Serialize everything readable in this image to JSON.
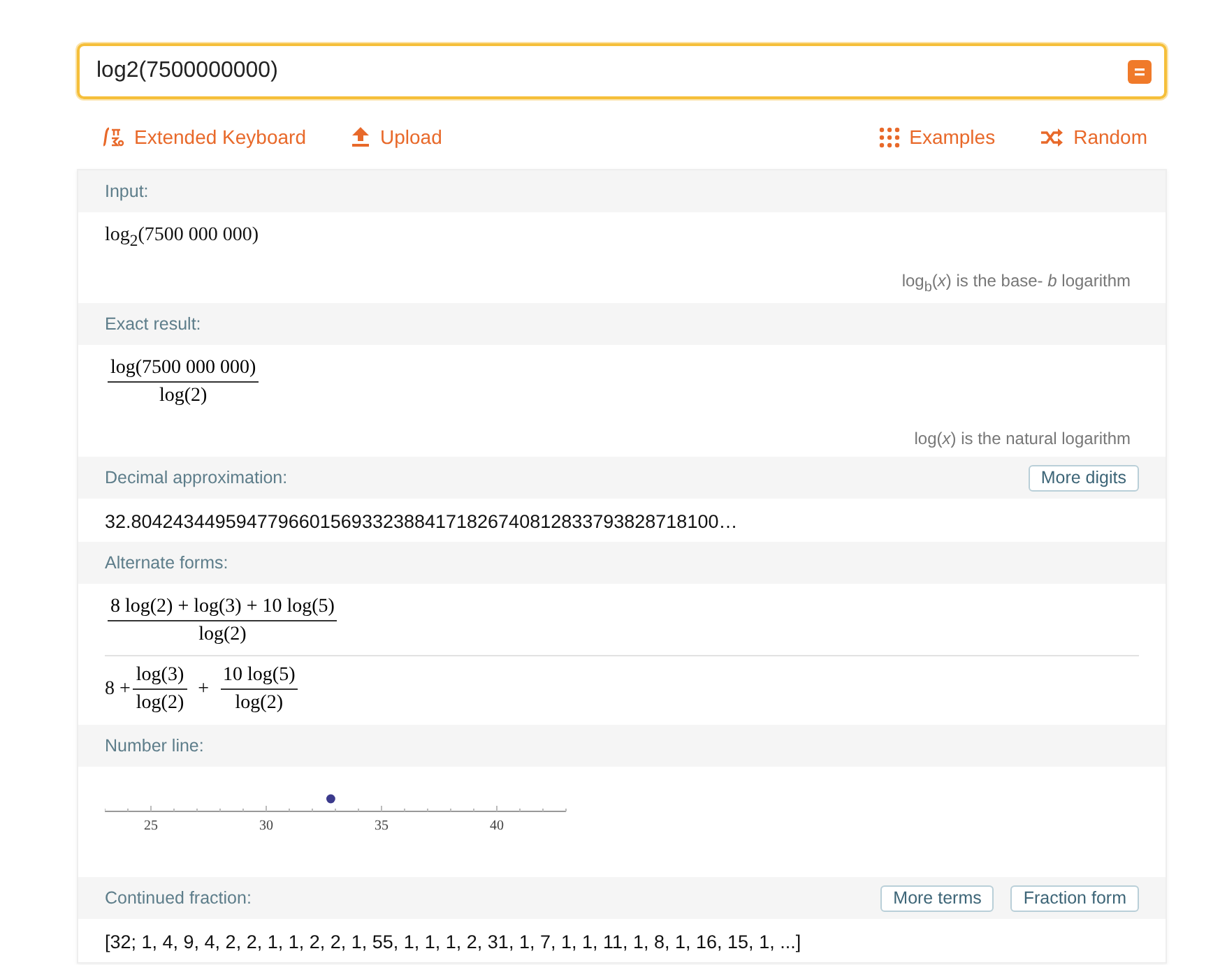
{
  "search": {
    "value": "log2(7500000000)"
  },
  "links": [
    {
      "kind": "keyboard",
      "label": "Extended Keyboard"
    },
    {
      "kind": "upload",
      "label": "Upload"
    },
    {
      "kind": "examples",
      "label": "Examples"
    },
    {
      "kind": "random",
      "label": "Random"
    }
  ],
  "pods": [
    {
      "title": "Input:",
      "blocks": [
        {
          "kind": "text",
          "text": "log$_{2}$(7500 000 000)"
        }
      ],
      "note": "log$_{b}$(*x*) is the base- *b* logarithm"
    },
    {
      "title": "Exact result:",
      "blocks": [
        {
          "kind": "frac",
          "num": "log(7500 000 000)",
          "den": "log(2)"
        }
      ],
      "note": "log(*x*) is the natural logarithm"
    },
    {
      "title": "Decimal approximation:",
      "buttons": [
        "More digits"
      ],
      "blocks": [
        {
          "kind": "plain",
          "text": "32.80424344959477966015693323884171826740812833793828718100…"
        }
      ]
    },
    {
      "title": "Alternate forms:",
      "blocks": [
        {
          "kind": "frac",
          "num": "8 log(2) + log(3) + 10 log(5)",
          "den": "log(2)"
        },
        {
          "kind": "sum",
          "lead": "8 +",
          "fracs": [
            {
              "num": "log(3)",
              "den": "log(2)"
            },
            {
              "num": "10 log(5)",
              "den": "log(2)"
            }
          ],
          "ops": [
            "+"
          ]
        }
      ]
    },
    {
      "title": "Number line:",
      "blocks": [
        {
          "kind": "numberline",
          "tick_labels": [
            "25",
            "30",
            "35",
            "40"
          ],
          "point": {
            "level": 0.49
          }
        }
      ]
    },
    {
      "title": "Continued fraction:",
      "buttons": [
        "More terms",
        "Fraction form"
      ],
      "blocks": [
        {
          "kind": "plain",
          "text": "[32; 1, 4, 9, 4, 2, 2, 1, 1, 2, 2, 1, 55, 1, 1, 1, 2, 31, 1, 7, 1, 1, 11, 1, 8, 1, 16, 15, 1, ...]"
        }
      ]
    }
  ]
}
